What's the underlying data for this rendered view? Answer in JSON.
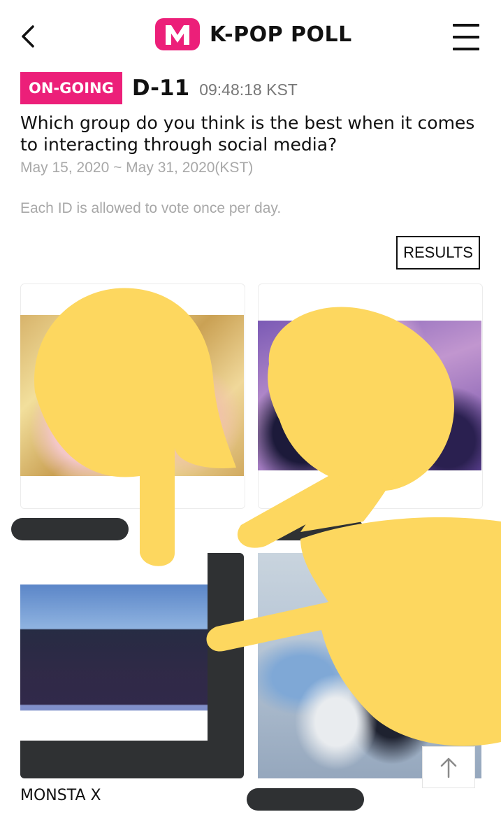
{
  "header": {
    "title": "K-POP POLL",
    "logo_letter": "M",
    "back_icon": "chevron-left-icon",
    "menu_icon": "hamburger-menu-icon"
  },
  "poll": {
    "status": "ON-GOING",
    "d_day": "D-11",
    "time_left": "09:48:18 KST",
    "question": "Which group do you think is the best when it comes to interacting through social media?",
    "period": "May 15, 2020 ~ May 31, 2020(KST)",
    "rule": "Each ID is allowed to vote once per day.",
    "results_label": "RESULTS"
  },
  "candidates": [
    {
      "name": ""
    },
    {
      "name": ""
    },
    {
      "name": "MONSTA X"
    },
    {
      "name": ""
    }
  ],
  "scroll_top_icon": "arrow-up-icon",
  "colors": {
    "brand_pink": "#ec1f79",
    "doodle_yellow": "#fdd75f",
    "redaction": "#2f3133"
  }
}
